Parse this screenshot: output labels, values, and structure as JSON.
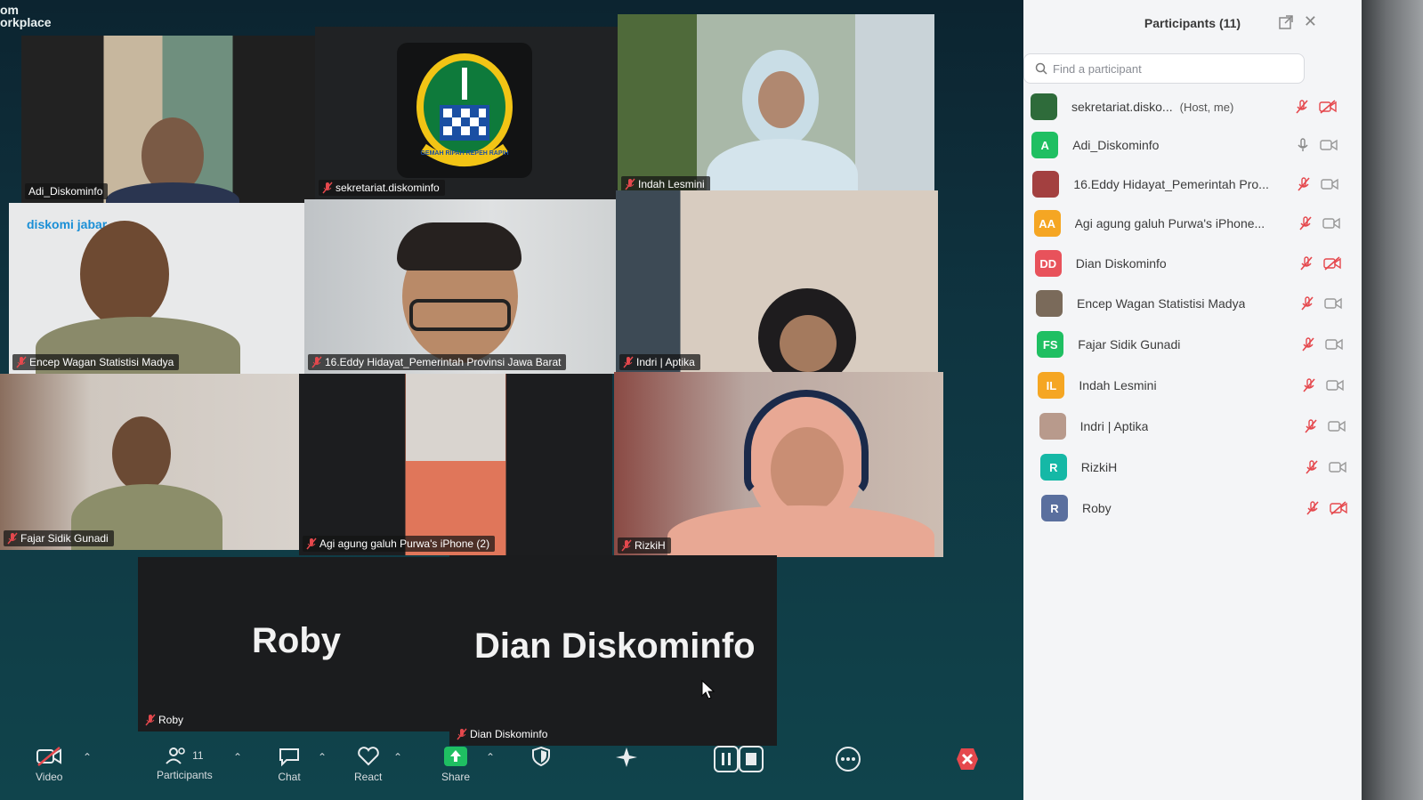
{
  "window": {
    "title": "om\norkplace"
  },
  "tiles": [
    {
      "name": "Adi_Diskominfo",
      "muted": false,
      "active": true
    },
    {
      "name": "sekretariat.diskominfo",
      "muted": true,
      "active": false
    },
    {
      "name": "Indah Lesmini",
      "muted": true,
      "active": false
    },
    {
      "name": "Encep Wagan Statistisi Madya",
      "muted": true,
      "active": false
    },
    {
      "name": "16.Eddy Hidayat_Pemerintah Provinsi Jawa Barat",
      "muted": true,
      "active": false
    },
    {
      "name": "Indri | Aptika",
      "muted": true,
      "active": false
    },
    {
      "name": "Fajar Sidik Gunadi",
      "muted": true,
      "active": false
    },
    {
      "name": "Agi agung galuh Purwa's iPhone (2)",
      "muted": true,
      "active": false
    },
    {
      "name": "RizkiH",
      "muted": true,
      "active": false
    }
  ],
  "video_off_tiles": [
    {
      "display_name": "Roby",
      "label": "Roby"
    },
    {
      "display_name": "Dian Diskominfo",
      "label": "Dian Diskominfo"
    }
  ],
  "tile_text": {
    "logo_caption": "GEMAH RIPAH REPEH RAPIH",
    "bg_logo_text": "diskomi jabar"
  },
  "toolbar": {
    "video_label": "Video",
    "participants_label": "Participants",
    "participants_count": "11",
    "chat_label": "Chat",
    "react_label": "React",
    "share_label": "Share"
  },
  "panel": {
    "title": "Participants (11)",
    "search_placeholder": "Find a participant",
    "participants": [
      {
        "name": "sekretariat.disko...",
        "role": "(Host, me)",
        "avatar": "",
        "avatar_color": "#2e6b3a",
        "mic": "muted",
        "video": "off"
      },
      {
        "name": "Adi_Diskominfo",
        "role": "",
        "avatar": "A",
        "avatar_color": "#1fbf62",
        "mic": "on",
        "video": "on"
      },
      {
        "name": "16.Eddy Hidayat_Pemerintah Pro...",
        "role": "",
        "avatar": "",
        "avatar_color": "#a34040",
        "mic": "muted",
        "video": "on"
      },
      {
        "name": "Agi agung galuh Purwa's iPhone...",
        "role": "",
        "avatar": "AA",
        "avatar_color": "#f5a623",
        "mic": "muted",
        "video": "on"
      },
      {
        "name": "Dian Diskominfo",
        "role": "",
        "avatar": "DD",
        "avatar_color": "#e8525b",
        "mic": "muted",
        "video": "off"
      },
      {
        "name": "Encep Wagan Statistisi Madya",
        "role": "",
        "avatar": "",
        "avatar_color": "#7a6a5a",
        "mic": "muted",
        "video": "on"
      },
      {
        "name": "Fajar Sidik Gunadi",
        "role": "",
        "avatar": "FS",
        "avatar_color": "#1fbf62",
        "mic": "muted",
        "video": "on"
      },
      {
        "name": "Indah Lesmini",
        "role": "",
        "avatar": "IL",
        "avatar_color": "#f5a623",
        "mic": "muted",
        "video": "on"
      },
      {
        "name": "Indri | Aptika",
        "role": "",
        "avatar": "",
        "avatar_color": "#b89a8c",
        "mic": "muted",
        "video": "on"
      },
      {
        "name": "RizkiH",
        "role": "",
        "avatar": "R",
        "avatar_color": "#15b8a6",
        "mic": "muted",
        "video": "on"
      },
      {
        "name": "Roby",
        "role": "",
        "avatar": "R",
        "avatar_color": "#5a6f9e",
        "mic": "muted",
        "video": "off"
      }
    ]
  },
  "colors": {
    "active_speaker": "#21c25e",
    "muted_red": "#e5484d",
    "share_green": "#1fbf62"
  }
}
